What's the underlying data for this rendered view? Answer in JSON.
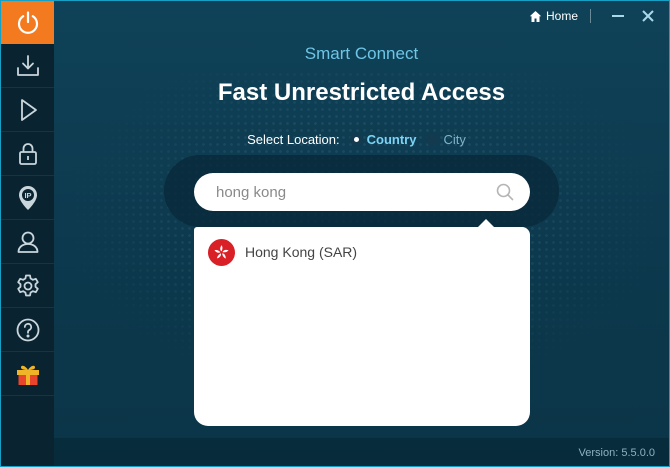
{
  "window": {
    "home_label": "Home",
    "version_text": "Version: 5.5.0.0"
  },
  "sidebar": {
    "items": [
      {
        "name": "power",
        "icon": "power-icon",
        "active": true
      },
      {
        "name": "downloads",
        "icon": "download-icon",
        "active": false
      },
      {
        "name": "streaming",
        "icon": "play-icon",
        "active": false
      },
      {
        "name": "privacy",
        "icon": "lock-icon",
        "active": false
      },
      {
        "name": "ip",
        "icon": "ip-pin-icon",
        "active": false
      },
      {
        "name": "account",
        "icon": "user-icon",
        "active": false
      },
      {
        "name": "settings",
        "icon": "gear-icon",
        "active": false
      },
      {
        "name": "help",
        "icon": "help-icon",
        "active": false
      },
      {
        "name": "gift",
        "icon": "gift-icon",
        "active": false
      }
    ]
  },
  "main": {
    "subtitle": "Smart Connect",
    "title": "Fast Unrestricted Access",
    "location_label": "Select Location:",
    "options": [
      {
        "label": "Country",
        "selected": true
      },
      {
        "label": "City",
        "selected": false
      }
    ],
    "search": {
      "value": "hong kong",
      "placeholder": ""
    },
    "results": [
      {
        "label": "Hong Kong (SAR)",
        "flag": "hong-kong-flag"
      }
    ]
  },
  "colors": {
    "accent": "#f47a20",
    "subtitle": "#6ec5e6",
    "selected_option": "#7dd3f5",
    "background": "#0f4258",
    "sidebar": "#0a2330"
  }
}
